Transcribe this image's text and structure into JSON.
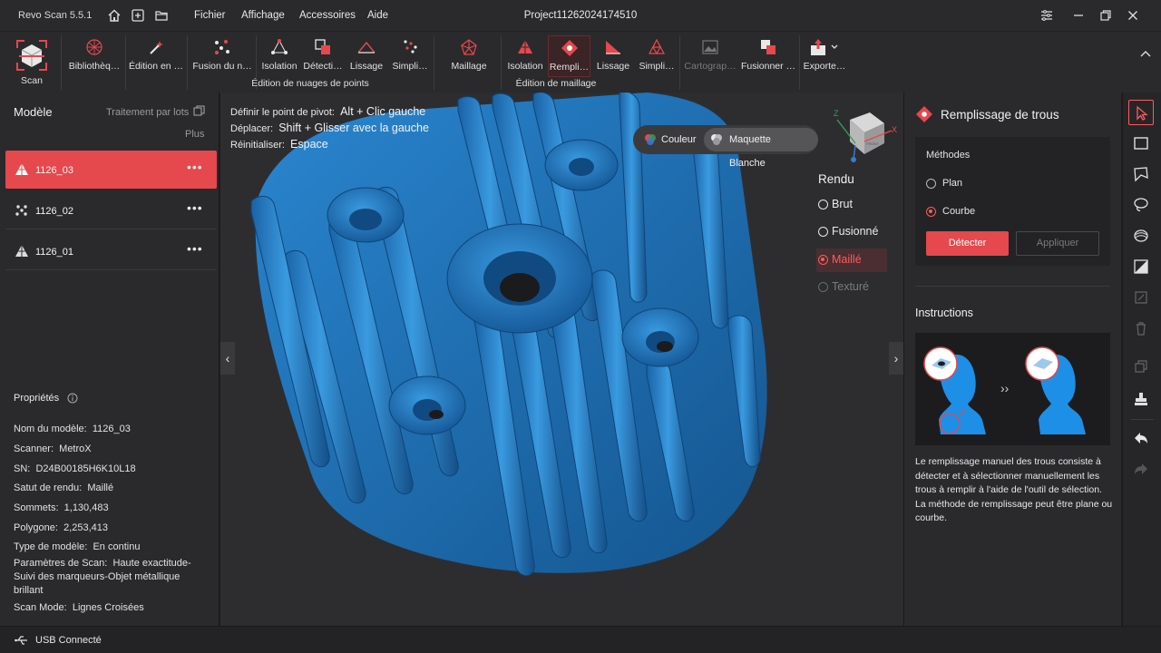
{
  "app": {
    "title": "Revo Scan 5.5.1",
    "project": "Project11262024174510"
  },
  "menu": [
    "Fichier",
    "Affichage",
    "Accessoires",
    "Aide"
  ],
  "ribbon": {
    "scan": "Scan",
    "buttons": [
      "Bibliothèq…",
      "Édition en …",
      "Fusion du n…",
      "Isolation",
      "Détecti…",
      "Lissage",
      "Simpli…",
      "Maillage",
      "Isolation",
      "Rempli…",
      "Lissage",
      "Simpli…",
      "Cartograp…",
      "Fusionner …",
      "Exporte…"
    ],
    "groups": {
      "point_cloud": "Édition de nuages de points",
      "mesh": "Édition de maillage"
    }
  },
  "left_panel": {
    "title": "Modèle",
    "batch": "Traitement par lots",
    "more": "Plus",
    "models": [
      {
        "name": "1126_03",
        "icon": "mesh-triangle-icon",
        "selected": true
      },
      {
        "name": "1126_02",
        "icon": "point-cloud-icon",
        "selected": false
      },
      {
        "name": "1126_01",
        "icon": "mesh-triangle-icon",
        "selected": false
      }
    ],
    "more_glyph": "•••",
    "properties_title": "Propriétés",
    "properties": [
      {
        "key": "Nom du modèle:",
        "value": "1126_03"
      },
      {
        "key": "Scanner:",
        "value": "MetroX"
      },
      {
        "key": "SN:",
        "value": "D24B00185H6K10L18"
      },
      {
        "key": "Satut de rendu:",
        "value": "Maillé"
      },
      {
        "key": "Sommets:",
        "value": "1,130,483"
      },
      {
        "key": "Polygone:",
        "value": "2,253,413"
      },
      {
        "key": "Type de modèle:",
        "value": "En continu"
      },
      {
        "key": "Paramètres de Scan:",
        "value": "Haute exactitude-Suivi des marqueurs-Objet métallique brillant"
      },
      {
        "key": "Scan Mode:",
        "value": "Lignes Croisées"
      }
    ]
  },
  "viewport": {
    "hints": [
      {
        "label": "Définir le point de pivot:",
        "keys": "Alt + Clic gauche"
      },
      {
        "label": "Déplacer:",
        "keys": "Shift + Glisser avec la gauche"
      },
      {
        "label": "Réinitialiser:",
        "keys": "Espace"
      }
    ],
    "color_mode": {
      "color": "Couleur",
      "white": "Maquette Blanche"
    },
    "render": {
      "title": "Rendu",
      "options": [
        {
          "label": "Brut",
          "state": "normal"
        },
        {
          "label": "Fusionné",
          "state": "normal"
        },
        {
          "label": "Maillé",
          "state": "active"
        },
        {
          "label": "Texturé",
          "state": "disabled"
        }
      ]
    },
    "gizmo": {
      "x": "X",
      "z": "Z",
      "face": "FRONT"
    },
    "mesh_color": "#1e6db4"
  },
  "right_panel": {
    "title": "Remplissage de trous",
    "methods_label": "Méthodes",
    "methods": [
      {
        "label": "Plan",
        "selected": false
      },
      {
        "label": "Courbe",
        "selected": true
      }
    ],
    "detect": "Détecter",
    "apply": "Appliquer",
    "instructions_title": "Instructions",
    "instructions_text": "Le remplissage manuel des trous consiste à détecter et à sélectionner manuellement les trous à remplir à l'aide de l'outil de sélection. La méthode de remplissage peut être plane ou courbe."
  },
  "status": {
    "usb": "USB Connecté"
  },
  "colors": {
    "accent": "#e5484d",
    "panel": "#2a2a2c",
    "viewport": "#2d2d30"
  }
}
